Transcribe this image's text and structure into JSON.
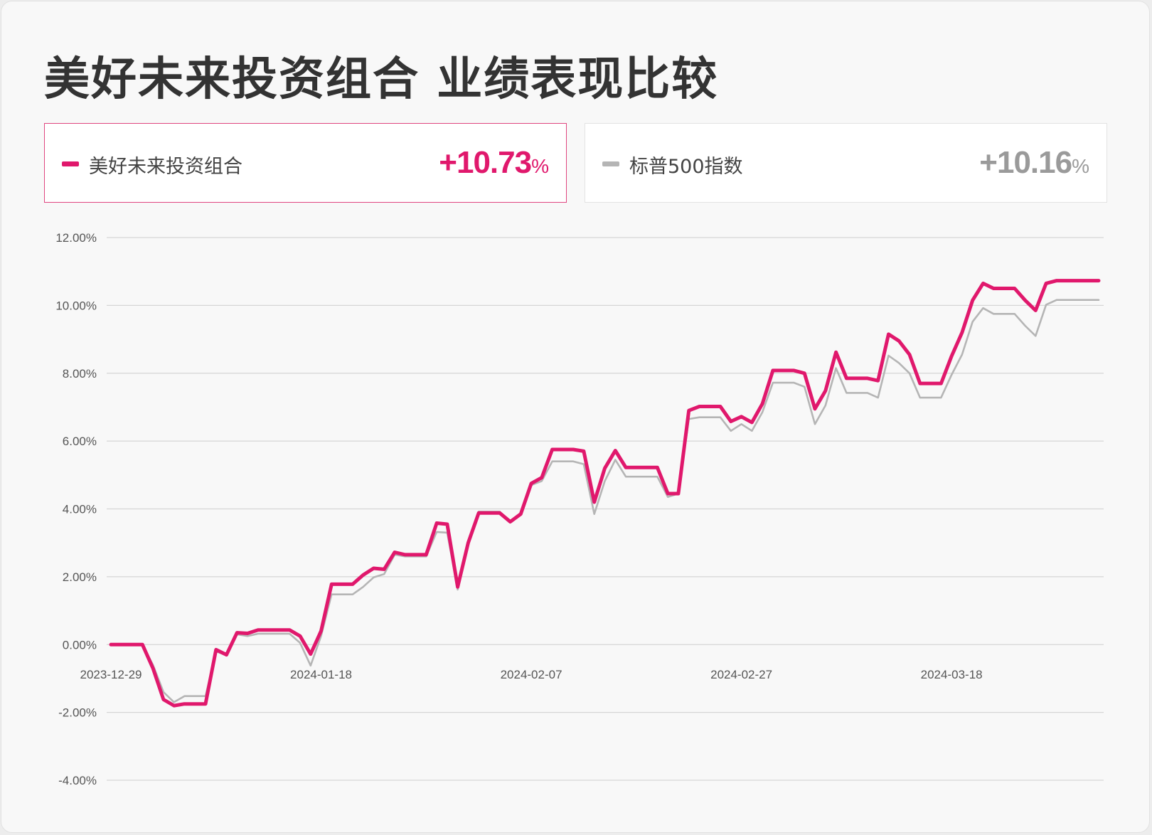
{
  "title": "美好未来投资组合 业绩表现比较",
  "legend": [
    {
      "label": "美好未来投资组合",
      "value": "+10.73",
      "unit": "%",
      "color": "#e0186c"
    },
    {
      "label": "标普500指数",
      "value": "+10.16",
      "unit": "%",
      "color": "#b5b5b5"
    }
  ],
  "chart_data": {
    "type": "line",
    "title": "美好未来投资组合 业绩表现比较",
    "xlabel": "",
    "ylabel": "",
    "ylim": [
      -4,
      12
    ],
    "yticks": [
      -4,
      -2,
      0,
      2,
      4,
      6,
      8,
      10,
      12
    ],
    "ytick_labels": [
      "-4.00%",
      "-2.00%",
      "0.00%",
      "2.00%",
      "4.00%",
      "6.00%",
      "8.00%",
      "10.00%",
      "12.00%"
    ],
    "xlim": [
      "2023-12-29",
      "2024-04-01"
    ],
    "xticks": [
      "2023-12-29",
      "2024-01-18",
      "2024-02-07",
      "2024-02-27",
      "2024-03-18"
    ],
    "grid": true,
    "x": [
      "2023-12-29",
      "2023-12-30",
      "2023-12-31",
      "2024-01-01",
      "2024-01-02",
      "2024-01-03",
      "2024-01-04",
      "2024-01-05",
      "2024-01-06",
      "2024-01-07",
      "2024-01-08",
      "2024-01-09",
      "2024-01-10",
      "2024-01-11",
      "2024-01-12",
      "2024-01-13",
      "2024-01-14",
      "2024-01-15",
      "2024-01-16",
      "2024-01-17",
      "2024-01-18",
      "2024-01-19",
      "2024-01-20",
      "2024-01-21",
      "2024-01-22",
      "2024-01-23",
      "2024-01-24",
      "2024-01-25",
      "2024-01-26",
      "2024-01-27",
      "2024-01-28",
      "2024-01-29",
      "2024-01-30",
      "2024-01-31",
      "2024-02-01",
      "2024-02-02",
      "2024-02-03",
      "2024-02-04",
      "2024-02-05",
      "2024-02-06",
      "2024-02-07",
      "2024-02-08",
      "2024-02-09",
      "2024-02-10",
      "2024-02-11",
      "2024-02-12",
      "2024-02-13",
      "2024-02-14",
      "2024-02-15",
      "2024-02-16",
      "2024-02-17",
      "2024-02-18",
      "2024-02-19",
      "2024-02-20",
      "2024-02-21",
      "2024-02-22",
      "2024-02-23",
      "2024-02-24",
      "2024-02-25",
      "2024-02-26",
      "2024-02-27",
      "2024-02-28",
      "2024-02-29",
      "2024-03-01",
      "2024-03-02",
      "2024-03-03",
      "2024-03-04",
      "2024-03-05",
      "2024-03-06",
      "2024-03-07",
      "2024-03-08",
      "2024-03-09",
      "2024-03-10",
      "2024-03-11",
      "2024-03-12",
      "2024-03-13",
      "2024-03-14",
      "2024-03-15",
      "2024-03-16",
      "2024-03-17",
      "2024-03-18",
      "2024-03-19",
      "2024-03-20",
      "2024-03-21",
      "2024-03-22",
      "2024-03-23",
      "2024-03-24",
      "2024-03-25",
      "2024-03-26",
      "2024-03-27",
      "2024-03-28",
      "2024-03-29",
      "2024-03-30",
      "2024-03-31",
      "2024-04-01"
    ],
    "series": [
      {
        "name": "美好未来投资组合",
        "color": "#e0186c",
        "values": [
          0,
          0,
          0,
          0,
          -0.7,
          -1.62,
          -1.8,
          -1.75,
          -1.75,
          -1.75,
          -0.15,
          -0.3,
          0.35,
          0.33,
          0.43,
          0.43,
          0.43,
          0.43,
          0.25,
          -0.28,
          0.4,
          1.78,
          1.78,
          1.78,
          2.05,
          2.25,
          2.22,
          2.72,
          2.65,
          2.65,
          2.65,
          3.58,
          3.55,
          1.7,
          3.0,
          3.88,
          3.88,
          3.88,
          3.62,
          3.85,
          4.75,
          4.92,
          5.75,
          5.75,
          5.75,
          5.7,
          4.2,
          5.2,
          5.72,
          5.22,
          5.22,
          5.22,
          5.22,
          4.45,
          4.45,
          6.9,
          7.02,
          7.02,
          7.02,
          6.58,
          6.72,
          6.55,
          7.1,
          8.08,
          8.08,
          8.08,
          8.0,
          6.95,
          7.48,
          8.62,
          7.85,
          7.85,
          7.85,
          7.78,
          9.15,
          8.95,
          8.55,
          7.7,
          7.7,
          7.7,
          8.5,
          9.2,
          10.15,
          10.65,
          10.5,
          10.5,
          10.5,
          10.15,
          9.85,
          10.65,
          10.73,
          10.73,
          10.73,
          10.73,
          10.73
        ]
      },
      {
        "name": "标普500指数",
        "color": "#b5b5b5",
        "values": [
          0,
          0,
          0,
          0,
          -0.6,
          -1.4,
          -1.7,
          -1.52,
          -1.52,
          -1.52,
          -0.2,
          -0.32,
          0.3,
          0.25,
          0.32,
          0.32,
          0.32,
          0.32,
          0.05,
          -0.62,
          0.25,
          1.48,
          1.48,
          1.48,
          1.7,
          1.98,
          2.08,
          2.65,
          2.6,
          2.6,
          2.6,
          3.32,
          3.3,
          1.62,
          2.98,
          3.92,
          3.92,
          3.92,
          3.6,
          3.85,
          4.7,
          4.82,
          5.4,
          5.4,
          5.4,
          5.32,
          3.85,
          4.82,
          5.45,
          4.95,
          4.95,
          4.95,
          4.95,
          4.35,
          4.45,
          6.65,
          6.7,
          6.7,
          6.7,
          6.3,
          6.5,
          6.3,
          6.85,
          7.72,
          7.72,
          7.72,
          7.6,
          6.5,
          7.05,
          8.15,
          7.42,
          7.42,
          7.42,
          7.28,
          8.52,
          8.3,
          8.0,
          7.28,
          7.28,
          7.28,
          7.95,
          8.55,
          9.52,
          9.92,
          9.75,
          9.75,
          9.75,
          9.4,
          9.1,
          10.02,
          10.16,
          10.16,
          10.16,
          10.16,
          10.16
        ]
      }
    ]
  }
}
